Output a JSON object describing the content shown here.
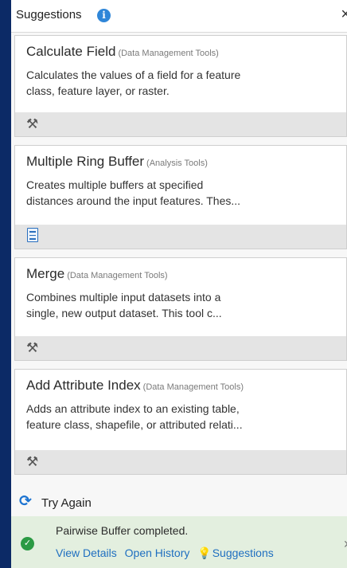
{
  "header": {
    "title": "Suggestions",
    "info_icon": "info-icon",
    "close_glyph": "×"
  },
  "cards": [
    {
      "name": "Calculate Field",
      "toolbox": "(Data Management Tools)",
      "desc_line1": "Calculates the values of a field for a feature",
      "desc_line2": "class, feature layer, or raster.",
      "icon": "hammer-icon"
    },
    {
      "name": "Multiple Ring Buffer",
      "toolbox": "(Analysis Tools)",
      "desc_line1": "Creates multiple buffers at specified",
      "desc_line2": "distances around the input features. Thes...",
      "icon": "script-tool-icon"
    },
    {
      "name": "Merge",
      "toolbox": "(Data Management Tools)",
      "desc_line1": "Combines multiple input datasets into a",
      "desc_line2": "single, new output dataset. This tool c...",
      "icon": "hammer-icon"
    },
    {
      "name": "Add Attribute Index",
      "toolbox": "(Data Management Tools)",
      "desc_line1": "Adds an attribute index to an existing table,",
      "desc_line2": "feature class, shapefile, or attributed relati...",
      "icon": "hammer-icon"
    }
  ],
  "try_again": {
    "label": "Try Again",
    "icon": "refresh-icon"
  },
  "status": {
    "message": "Pairwise Buffer completed.",
    "view_details": "View Details",
    "open_history": "Open History",
    "suggestions": "Suggestions",
    "color": "#2b9a44"
  }
}
